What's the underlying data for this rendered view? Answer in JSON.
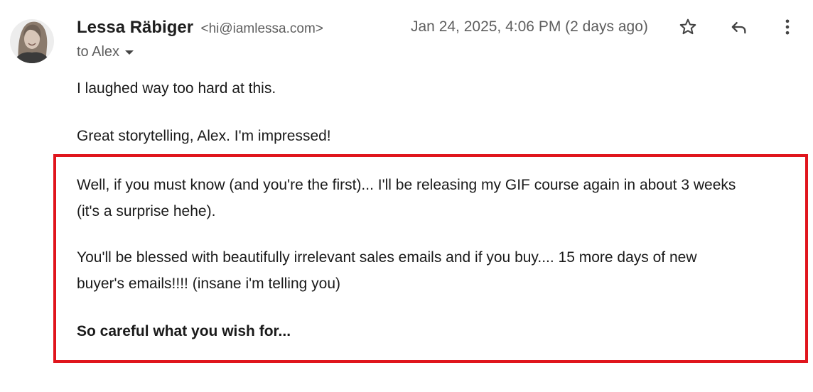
{
  "sender": {
    "name": "Lessa Räbiger",
    "email": "<hi@iamlessa.com>"
  },
  "date": "Jan 24, 2025, 4:06 PM (2 days ago)",
  "recipient": "to Alex",
  "body": {
    "line1": "I laughed way too hard at this.",
    "line2": "Great storytelling, Alex. I'm impressed!",
    "line3": "Well, if you must know (and you're the first)... I'll be releasing my GIF course again in about 3 weeks",
    "line4": "(it's a surprise hehe).",
    "line5": "You'll be blessed with beautifully irrelevant sales emails and if you buy.... 15 more days of new",
    "line6": "buyer's emails!!!! (insane i'm telling you)",
    "line7": "So careful what you wish for..."
  },
  "icons": {
    "star": "star-icon",
    "reply": "reply-icon",
    "more": "more-vert-icon",
    "dropdown": "chevron-down-icon"
  },
  "colors": {
    "highlight_border": "#e0151d",
    "secondary_text": "#5e5e5e"
  }
}
